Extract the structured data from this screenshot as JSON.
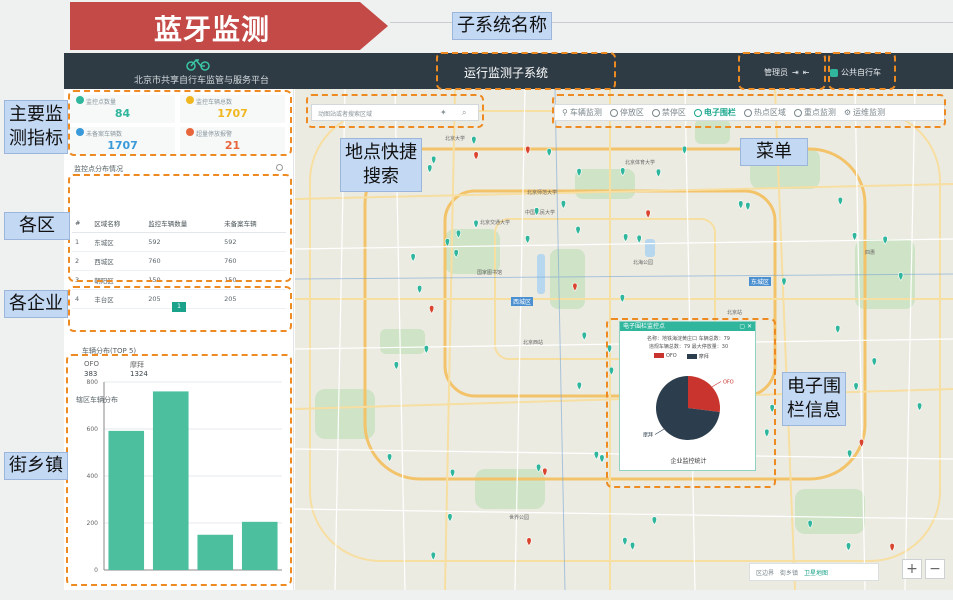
{
  "slide": {
    "title": "蓝牙监测"
  },
  "header": {
    "platform_name": "北京市共享自行车监管与服务平台",
    "subsystem_title": "运行监测子系统",
    "user_label": "管理员",
    "public_bike_label": "公共自行车"
  },
  "kpis": [
    {
      "label": "监控点数量",
      "value": "84",
      "color": "#2fb69c"
    },
    {
      "label": "监控车辆总数",
      "value": "1707",
      "color": "#f0b721"
    },
    {
      "label": "未备案车辆数",
      "value": "1707",
      "color": "#3a9ad9"
    },
    {
      "label": "超量停放报警",
      "value": "21",
      "color": "#e8663c"
    }
  ],
  "area_section": {
    "title": "监控点分布情况",
    "headers": [
      "#",
      "区域名称",
      "监控车辆数量",
      "未备案车辆"
    ],
    "rows": [
      [
        "1",
        "东城区",
        "592",
        "592"
      ],
      [
        "2",
        "西城区",
        "760",
        "760"
      ],
      [
        "3",
        "朝阳区",
        "150",
        "150"
      ],
      [
        "4",
        "丰台区",
        "205",
        "205"
      ]
    ],
    "page": "1"
  },
  "enterprise_section": {
    "title": "车辆分布(TOP 5)",
    "names": [
      "OFO",
      "摩拜"
    ],
    "values": [
      "383",
      "1324"
    ]
  },
  "street_section": {
    "title": "辖区车辆分布"
  },
  "chart_data": {
    "type": "bar",
    "categories": [
      "",
      "",
      "",
      ""
    ],
    "values": [
      592,
      760,
      150,
      205
    ],
    "ylim": [
      0,
      800
    ],
    "yticks": [
      0,
      200,
      400,
      600,
      800
    ],
    "color": "#4cbf9f",
    "grid": true
  },
  "map": {
    "search_placeholder": "动图站或者搜索区域",
    "menu": [
      {
        "label": "车辆监测",
        "icon": "bicycle-icon",
        "active": false
      },
      {
        "label": "停放区",
        "icon": "parking-icon",
        "active": false
      },
      {
        "label": "禁停区",
        "icon": "no-parking-icon",
        "active": false
      },
      {
        "label": "电子围栏",
        "icon": "fence-icon",
        "active": true
      },
      {
        "label": "热点区域",
        "icon": "hotspot-icon",
        "active": false
      },
      {
        "label": "重点监测",
        "icon": "focus-icon",
        "active": false
      },
      {
        "label": "运维监测",
        "icon": "gear-icon",
        "active": false
      }
    ],
    "district_labels": [
      "西城区",
      "东城区"
    ],
    "place_labels": [
      "北京师范大学",
      "北京交通大学",
      "国家图书馆",
      "北海公园",
      "北京站",
      "北京西站",
      "世界公园",
      "北京体育大学",
      "中国人民大学",
      "四惠",
      "北京大学"
    ],
    "popup": {
      "title": "电子围栏监控点",
      "line1": "名称：地铁海淀黄庄口  车辆总数：79",
      "line2": "违规车辆总数：79  最大停放量：30",
      "legend": [
        "OFO",
        "摩拜"
      ],
      "slice_labels": [
        "OFO",
        "摩拜"
      ],
      "footer": "企业监控统计"
    },
    "pie_data": {
      "type": "pie",
      "labels": [
        "OFO",
        "摩拜"
      ],
      "colors": [
        "#c9352e",
        "#2c3e4d"
      ],
      "values": [
        27,
        73
      ]
    },
    "tools": [
      "区边界",
      "街乡镇",
      "卫星地图"
    ],
    "zoom_in": "+",
    "zoom_out": "−"
  },
  "annotations": {
    "subsystem": "子系统名称",
    "kpi": "主要监\n测指标",
    "area": "各区",
    "enterprise": "各企业",
    "street": "街乡镇",
    "search": "地点快捷\n搜索",
    "menu": "菜单",
    "fence": "电子围\n栏信息"
  }
}
